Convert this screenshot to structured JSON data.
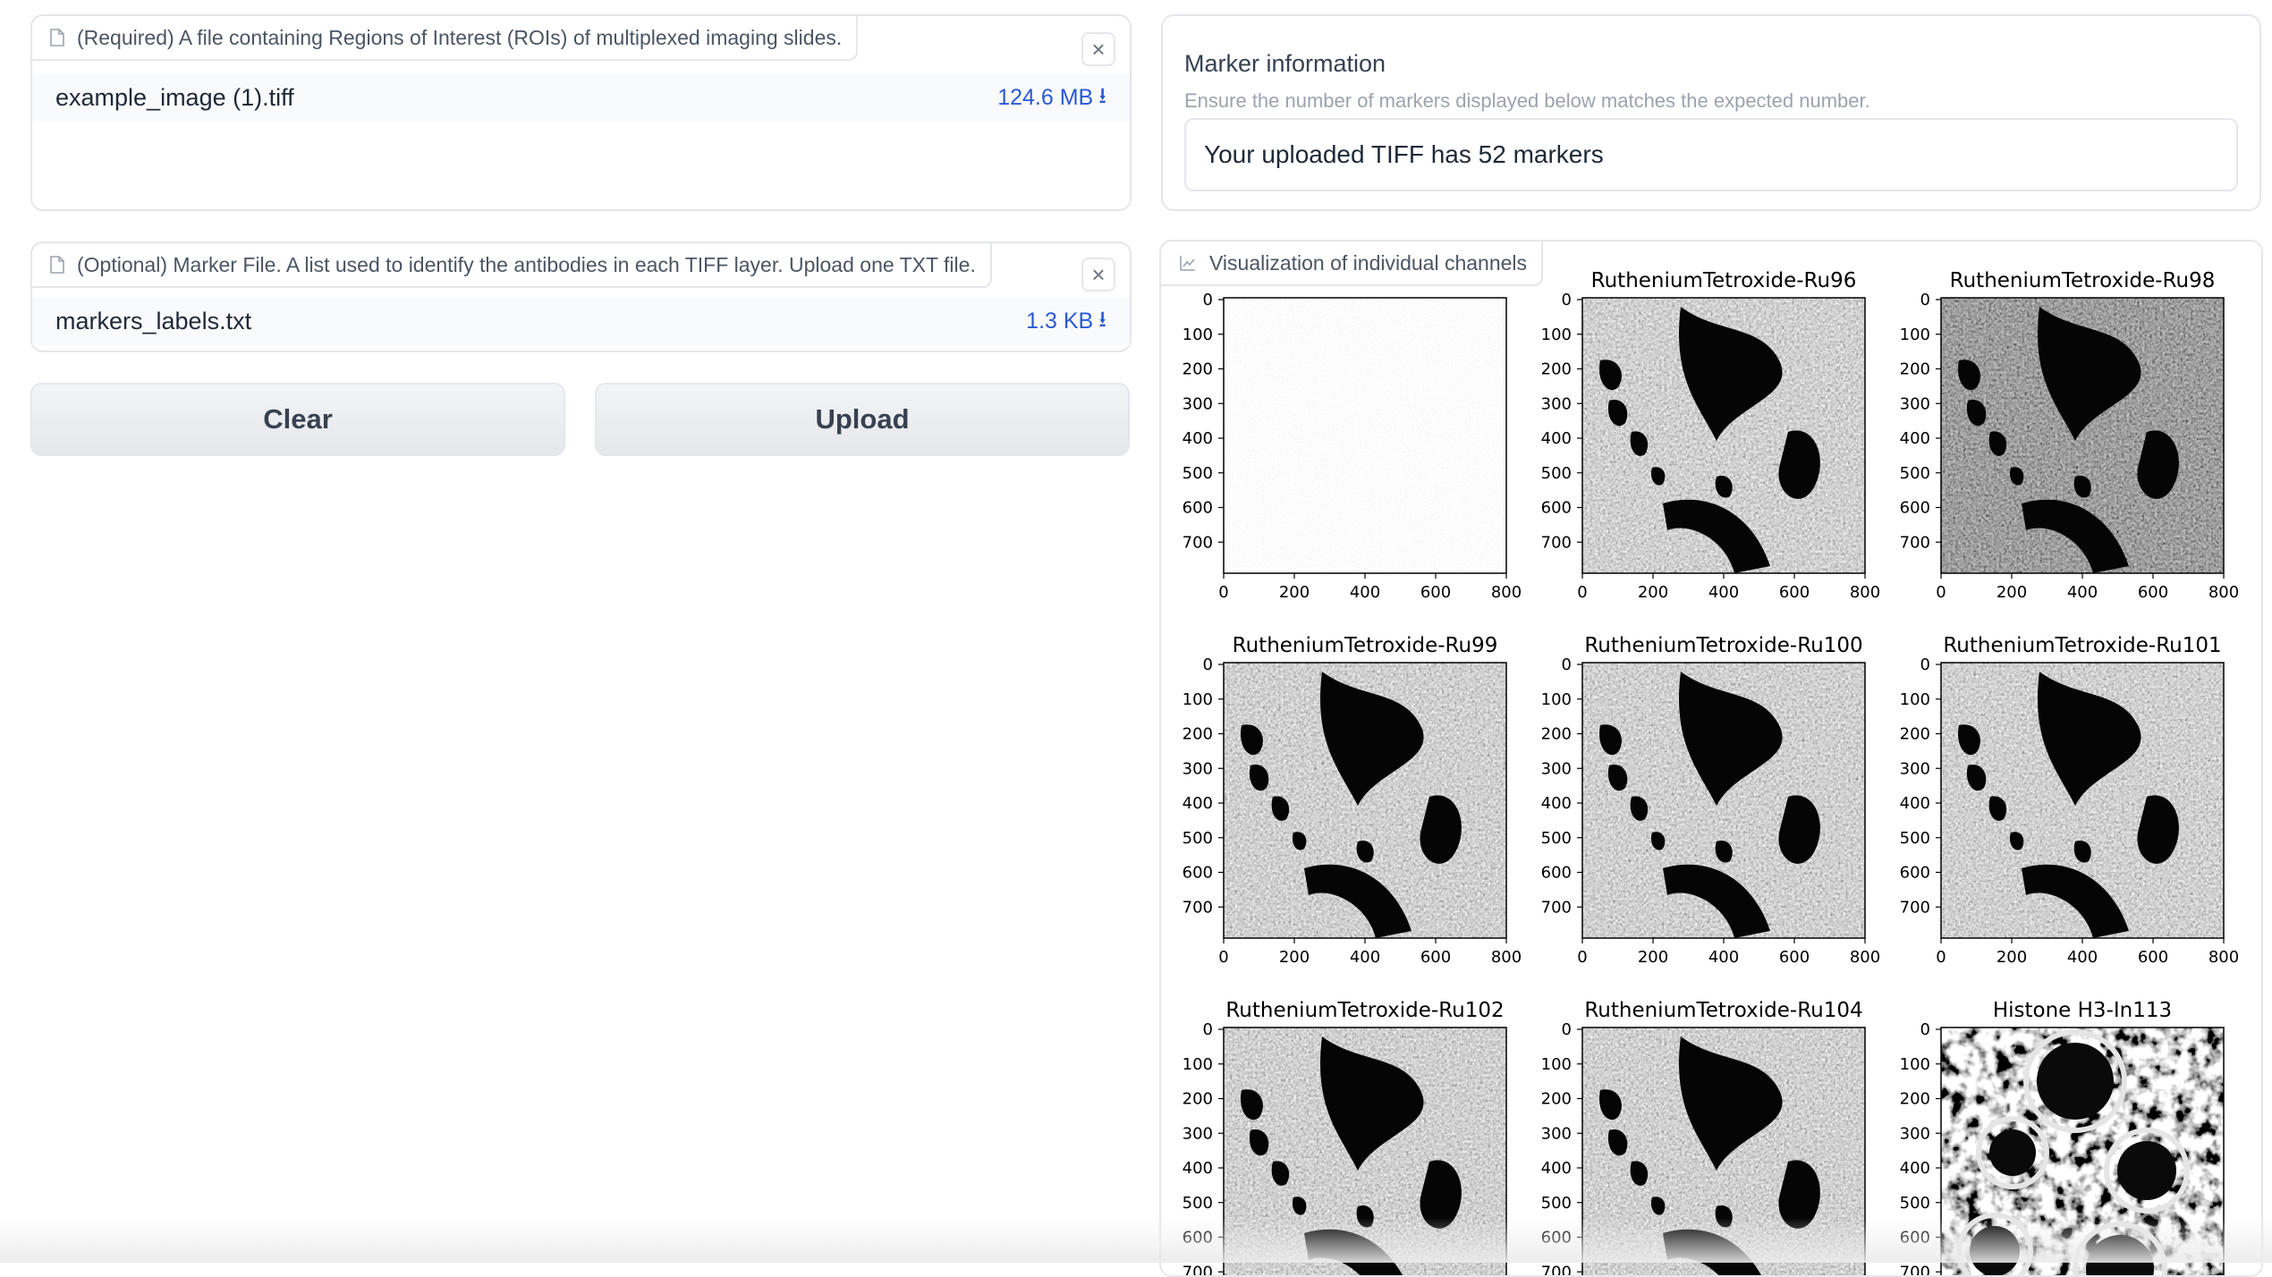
{
  "roi_upload": {
    "label": "(Required) A file containing Regions of Interest (ROIs) of multiplexed imaging slides.",
    "file_name": "example_image (1).tiff",
    "file_size": "124.6 MB",
    "close_glyph": "×",
    "download_glyph": "⭳"
  },
  "marker_upload": {
    "label": "(Optional) Marker File. A list used to identify the antibodies in each TIFF layer. Upload one TXT file.",
    "file_name": "markers_labels.txt",
    "file_size": "1.3 KB",
    "close_glyph": "×",
    "download_glyph": "⭳"
  },
  "buttons": {
    "clear": "Clear",
    "upload": "Upload"
  },
  "marker_info": {
    "title": "Marker information",
    "subtitle": "Ensure the number of markers displayed below matches the expected number.",
    "value": "Your uploaded TIFF has 52 markers"
  },
  "visualization": {
    "label": "Visualization of individual channels",
    "panels": [
      {
        "title": "",
        "style": "noise"
      },
      {
        "title": "RutheniumTetroxide-Ru96",
        "style": "tissue"
      },
      {
        "title": "RutheniumTetroxide-Ru98",
        "style": "tissue-dark"
      },
      {
        "title": "RutheniumTetroxide-Ru99",
        "style": "tissue"
      },
      {
        "title": "RutheniumTetroxide-Ru100",
        "style": "tissue"
      },
      {
        "title": "RutheniumTetroxide-Ru101",
        "style": "tissue"
      },
      {
        "title": "RutheniumTetroxide-Ru102",
        "style": "tissue"
      },
      {
        "title": "RutheniumTetroxide-Ru104",
        "style": "tissue"
      },
      {
        "title": "Histone H3-In113",
        "style": "histone"
      }
    ],
    "y_ticks": [
      "0",
      "100",
      "200",
      "300",
      "400",
      "500",
      "600",
      "700"
    ],
    "x_ticks": [
      "0",
      "200",
      "400",
      "600",
      "800"
    ]
  }
}
